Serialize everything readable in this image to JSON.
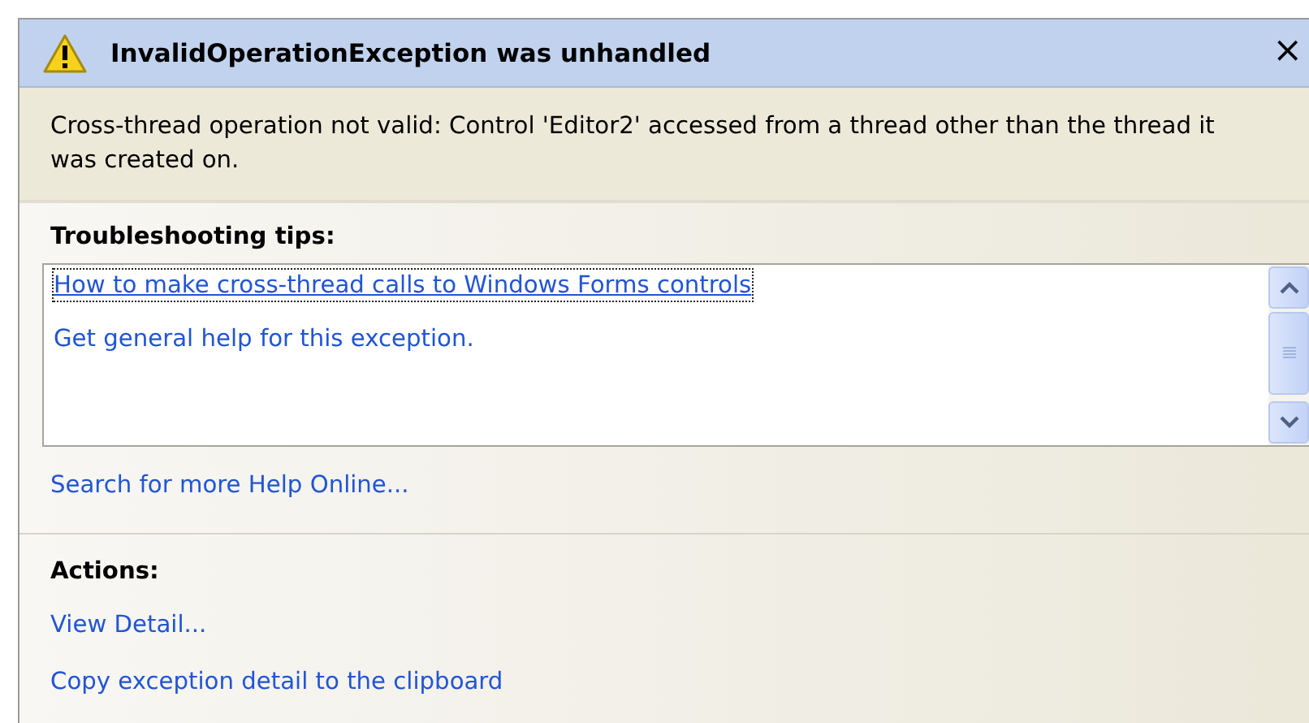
{
  "dialog": {
    "title": "InvalidOperationException was unhandled",
    "close": "×"
  },
  "message": "Cross-thread operation not valid: Control 'Editor2' accessed from a thread other than the thread it was created on.",
  "tips": {
    "heading": "Troubleshooting tips:",
    "items": [
      {
        "label": "How to make cross-thread calls to Windows Forms controls",
        "selected": true
      },
      {
        "label": "Get general help for this exception.",
        "selected": false
      }
    ]
  },
  "search_link": "Search for more Help Online...",
  "actions": {
    "heading": "Actions:",
    "items": [
      "View Detail...",
      "Copy exception detail to the clipboard"
    ]
  }
}
